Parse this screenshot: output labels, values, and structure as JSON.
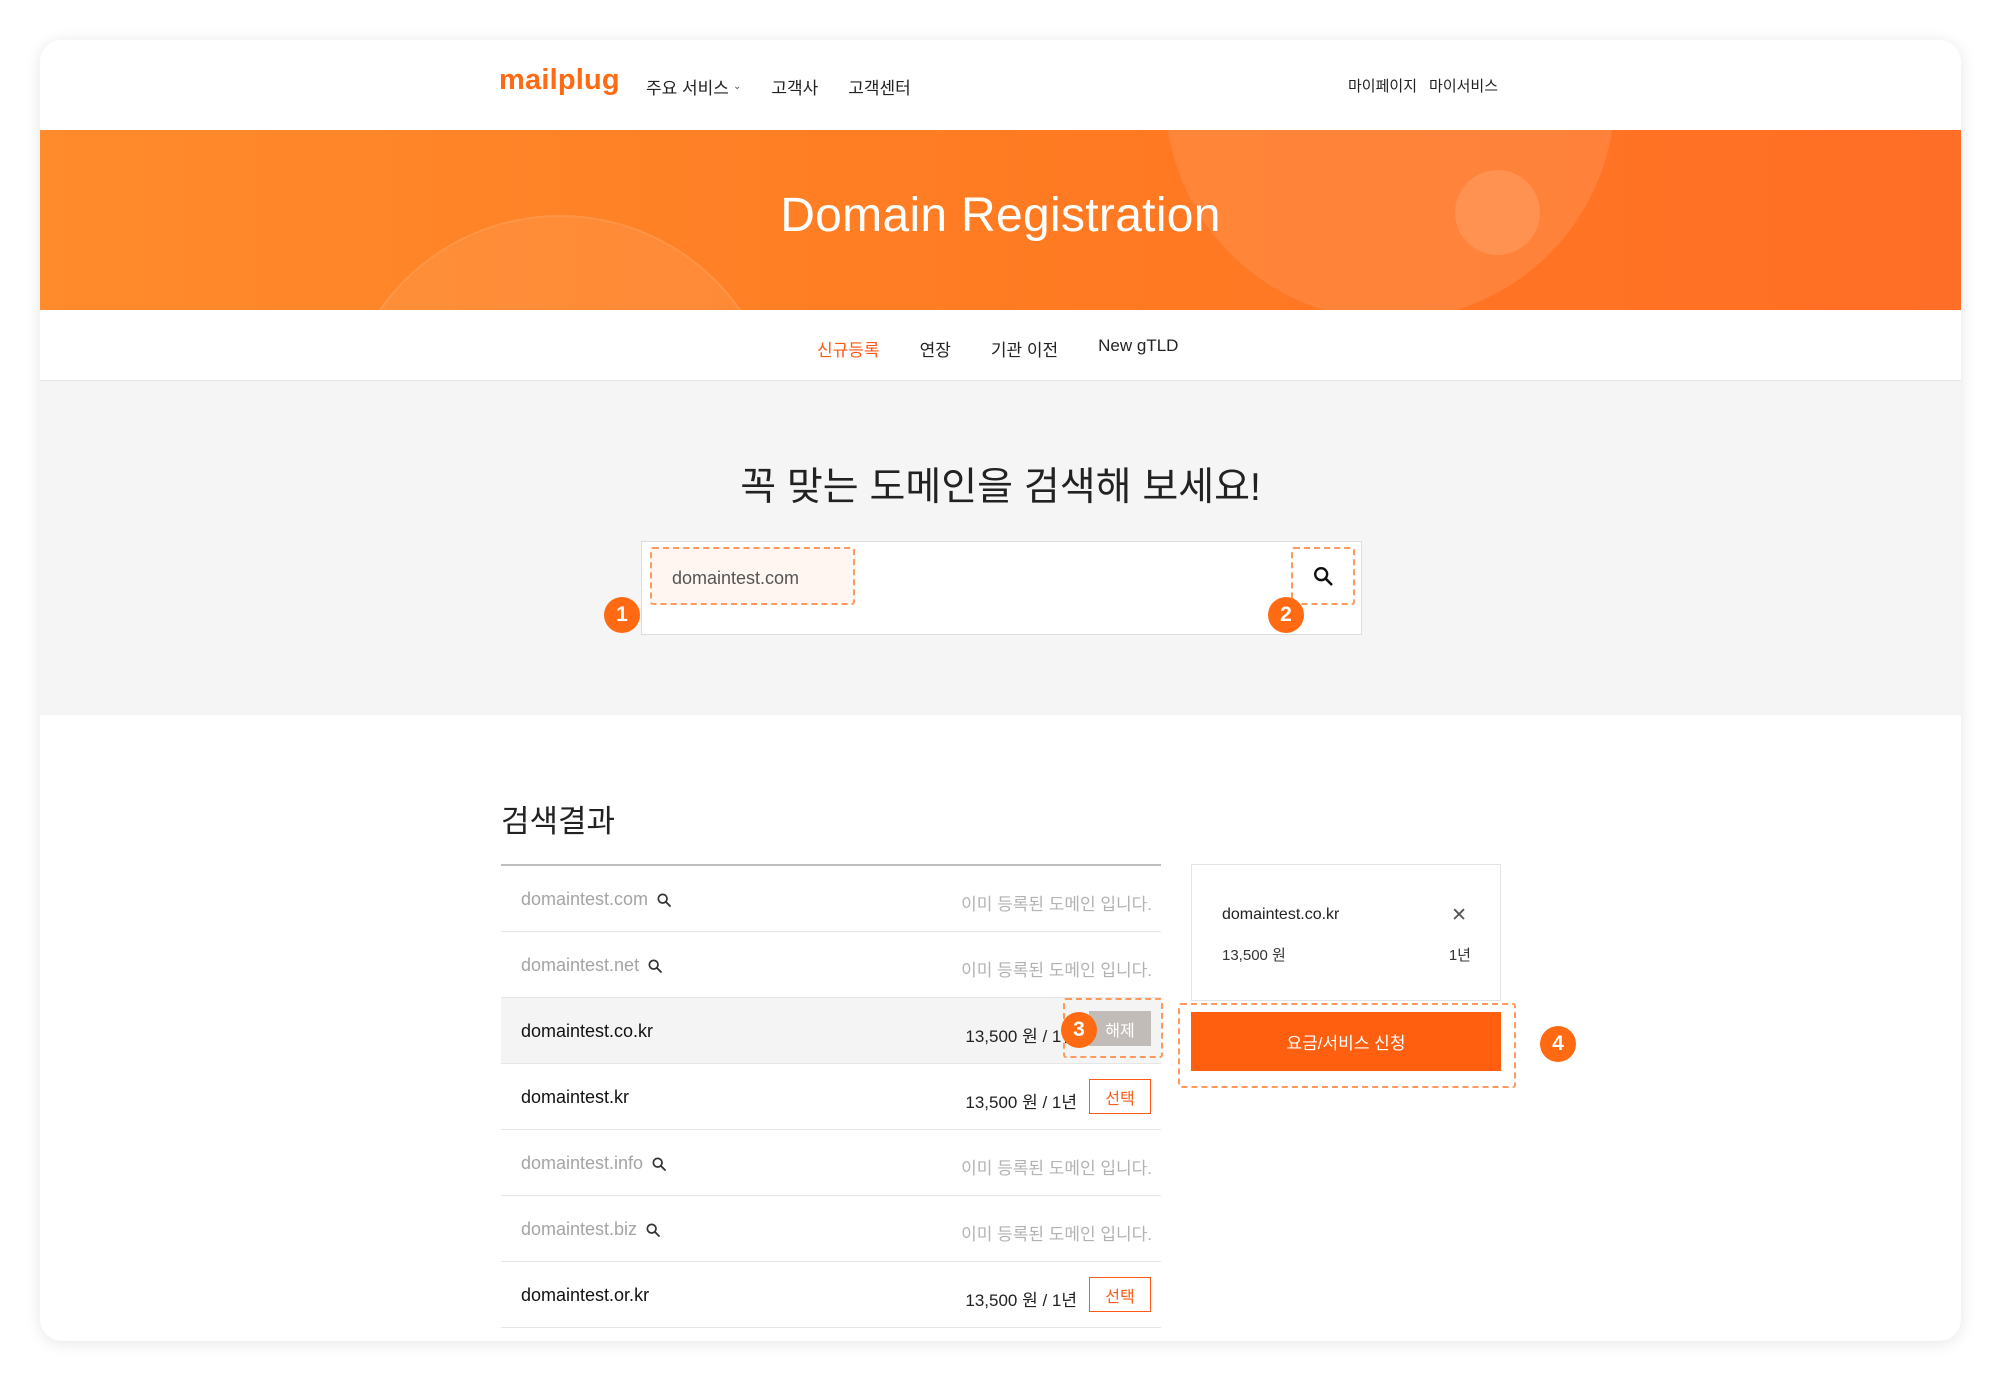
{
  "header": {
    "logo": "mailplug",
    "nav": [
      {
        "label": "주요 서비스",
        "has_dropdown": true
      },
      {
        "label": "고객사"
      },
      {
        "label": "고객센터"
      }
    ],
    "user_links": [
      "마이페이지",
      "마이서비스"
    ]
  },
  "banner": {
    "title": "Domain Registration"
  },
  "subtabs": [
    {
      "label": "신규등록",
      "active": true
    },
    {
      "label": "연장"
    },
    {
      "label": "기관 이전"
    },
    {
      "label": "New gTLD"
    }
  ],
  "search": {
    "heading": "꼭 맞는 도메인을 검색해 보세요!",
    "value": "domaintest.com"
  },
  "results": {
    "title": "검색결과",
    "rows": [
      {
        "domain": "domaintest.com",
        "taken": true,
        "status": "이미 등록된 도메인 입니다."
      },
      {
        "domain": "domaintest.net",
        "taken": true,
        "status": "이미 등록된 도메인 입니다."
      },
      {
        "domain": "domaintest.co.kr",
        "taken": false,
        "selected": true,
        "price": "13,500 원 / 1년",
        "action": "해제"
      },
      {
        "domain": "domaintest.kr",
        "taken": false,
        "selected": false,
        "price": "13,500 원 / 1년",
        "action": "선택"
      },
      {
        "domain": "domaintest.info",
        "taken": true,
        "status": "이미 등록된 도메인 입니다."
      },
      {
        "domain": "domaintest.biz",
        "taken": true,
        "status": "이미 등록된 도메인 입니다."
      },
      {
        "domain": "domaintest.or.kr",
        "taken": false,
        "selected": false,
        "price": "13,500 원 / 1년",
        "action": "선택"
      }
    ]
  },
  "cart": {
    "domain": "domaintest.co.kr",
    "price": "13,500 원",
    "term": "1년",
    "close_icon": "close-icon"
  },
  "apply_button": "요금/서비스 신청",
  "badges": [
    "1",
    "2",
    "3",
    "4"
  ],
  "colors": {
    "accent": "#ff6a13",
    "banner_start": "#ff8b2c",
    "banner_end": "#ff6e26",
    "dashed_highlight": "#ff9a5c"
  }
}
